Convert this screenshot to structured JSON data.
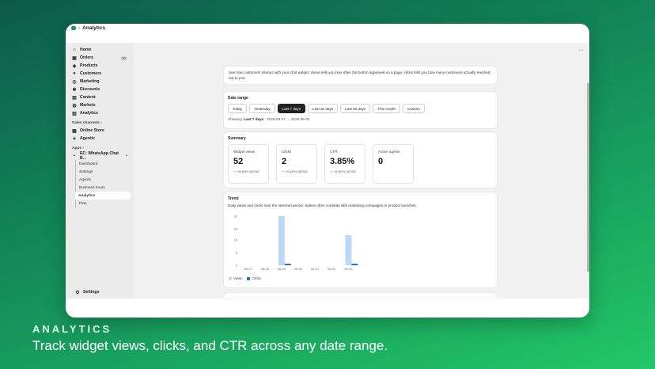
{
  "sidebar": {
    "items": [
      {
        "label": "Home",
        "icon": "home-icon"
      },
      {
        "label": "Orders",
        "icon": "orders-icon",
        "badge": "30"
      },
      {
        "label": "Products",
        "icon": "tag-icon"
      },
      {
        "label": "Customers",
        "icon": "person-icon"
      },
      {
        "label": "Marketing",
        "icon": "target-icon"
      },
      {
        "label": "Discounts",
        "icon": "discount-icon"
      },
      {
        "label": "Content",
        "icon": "content-icon"
      },
      {
        "label": "Markets",
        "icon": "globe-icon"
      },
      {
        "label": "Analytics",
        "icon": "chart-icon"
      }
    ],
    "sales_channels_label": "Sales channels",
    "channels": [
      {
        "label": "Online Store",
        "icon": "store-icon"
      },
      {
        "label": "Agentic",
        "icon": "agent-icon"
      }
    ],
    "apps_label": "Apps",
    "app_name": "EC: WhatsApp Chat B...",
    "app_sub_items": [
      "Dashboard",
      "Settings",
      "Agents",
      "Business hours",
      "Analytics",
      "Plan"
    ],
    "settings_label": "Settings"
  },
  "header": {
    "title": "Analytics",
    "more": "···"
  },
  "intro": {
    "text": "See how customers interact with your chat widget. Views tells you how often the button appeared on a page; clicks tells you how many customers actually reached out to you."
  },
  "date_range": {
    "title": "Date range",
    "options": [
      "Today",
      "Yesterday",
      "Last 7 days",
      "Last 30 days",
      "Last 90 days",
      "This month",
      "Custom"
    ],
    "active": "Last 7 days",
    "showing_label": "Showing:",
    "showing_range": "Last 7 days",
    "from": "2026-05-27",
    "to": "2026-06-02"
  },
  "summary": {
    "title": "Summary",
    "metrics": [
      {
        "label": "Widget views",
        "value": "52",
        "compare": "— vs prev period"
      },
      {
        "label": "Clicks",
        "value": "2",
        "compare": "— vs prev period"
      },
      {
        "label": "CTR",
        "value": "3.85%",
        "compare": "— vs prev period"
      },
      {
        "label": "Active agents",
        "value": "0",
        "compare": ""
      }
    ]
  },
  "trend": {
    "title": "Trend",
    "description": "Daily views and clicks over the selected period. Spikes often correlate with marketing campaigns or product launches."
  },
  "chart_data": {
    "type": "bar",
    "categories": [
      "05-27",
      "05-28",
      "05-29",
      "05-30",
      "05-31",
      "06-01",
      "06-02"
    ],
    "series": [
      {
        "name": "Views",
        "values": [
          0,
          0,
          31,
          0,
          0,
          0,
          19
        ],
        "color": "#bcd8f6"
      },
      {
        "name": "Clicks",
        "values": [
          0,
          0,
          1,
          0,
          0,
          0,
          1
        ],
        "color": "#2f6fd6"
      }
    ],
    "yticks": [
      0,
      8,
      16,
      23,
      31
    ],
    "ylim": [
      0,
      31
    ],
    "legend": "bottom-left"
  },
  "tagline_small": "ANALYTICS",
  "tagline": "Track widget views, clicks, and CTR across any date range."
}
